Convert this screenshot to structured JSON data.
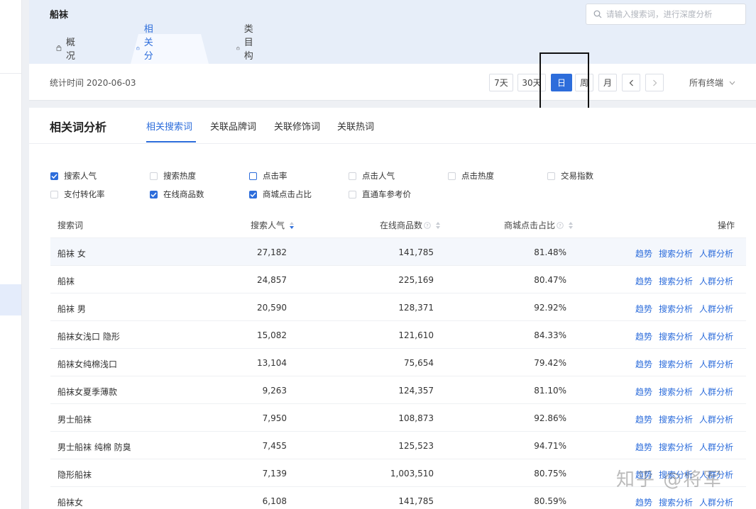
{
  "keyword": "船袜",
  "search": {
    "placeholder": "请输入搜索词，进行深度分析"
  },
  "tabs": [
    {
      "label": "概况"
    },
    {
      "label": "相关分析"
    },
    {
      "label": "类目构成"
    }
  ],
  "stat": {
    "time_label": "统计时间 2020-06-03",
    "periods": [
      {
        "label": "7天"
      },
      {
        "label": "30天"
      },
      {
        "label": "日"
      },
      {
        "label": "周"
      },
      {
        "label": "月"
      }
    ],
    "terminal": "所有终端"
  },
  "panel": {
    "title": "相关词分析",
    "subtabs": [
      {
        "label": "相关搜索词"
      },
      {
        "label": "关联品牌词"
      },
      {
        "label": "关联修饰词"
      },
      {
        "label": "关联热词"
      }
    ]
  },
  "metrics": [
    {
      "label": "搜索人气"
    },
    {
      "label": "搜索热度"
    },
    {
      "label": "点击率"
    },
    {
      "label": "点击人气"
    },
    {
      "label": "点击热度"
    },
    {
      "label": "交易指数"
    },
    {
      "label": "支付转化率"
    },
    {
      "label": "在线商品数"
    },
    {
      "label": "商城点击占比"
    },
    {
      "label": "直通车参考价"
    }
  ],
  "table": {
    "headers": {
      "keyword": "搜索词",
      "popularity": "搜索人气",
      "online_items": "在线商品数",
      "mall_click_ratio": "商城点击占比",
      "actions": "操作"
    },
    "rows": [
      {
        "keyword": "船袜 女",
        "popularity": "27,182",
        "online_items": "141,785",
        "mall_click_ratio": "81.48%"
      },
      {
        "keyword": "船袜",
        "popularity": "24,857",
        "online_items": "225,169",
        "mall_click_ratio": "80.47%"
      },
      {
        "keyword": "船袜 男",
        "popularity": "20,590",
        "online_items": "128,371",
        "mall_click_ratio": "92.92%"
      },
      {
        "keyword": "船袜女浅口 隐形",
        "popularity": "15,082",
        "online_items": "121,610",
        "mall_click_ratio": "84.33%"
      },
      {
        "keyword": "船袜女纯棉浅口",
        "popularity": "13,104",
        "online_items": "75,654",
        "mall_click_ratio": "79.42%"
      },
      {
        "keyword": "船袜女夏季薄款",
        "popularity": "9,263",
        "online_items": "124,357",
        "mall_click_ratio": "81.10%"
      },
      {
        "keyword": "男士船袜",
        "popularity": "7,950",
        "online_items": "108,873",
        "mall_click_ratio": "92.86%"
      },
      {
        "keyword": "男士船袜 纯棉 防臭",
        "popularity": "7,455",
        "online_items": "125,523",
        "mall_click_ratio": "94.71%"
      },
      {
        "keyword": "隐形船袜",
        "popularity": "7,139",
        "online_items": "1,003,510",
        "mall_click_ratio": "80.75%"
      },
      {
        "keyword": "船袜女",
        "popularity": "6,108",
        "online_items": "141,785",
        "mall_click_ratio": "80.59%"
      }
    ],
    "actions": {
      "trend": "趋势",
      "search_analysis": "搜索分析",
      "crowd_analysis": "人群分析"
    }
  },
  "watermark": "知乎 @将军",
  "colors": {
    "accent": "#2d6ddb",
    "header_bg": "#e7eef9"
  }
}
